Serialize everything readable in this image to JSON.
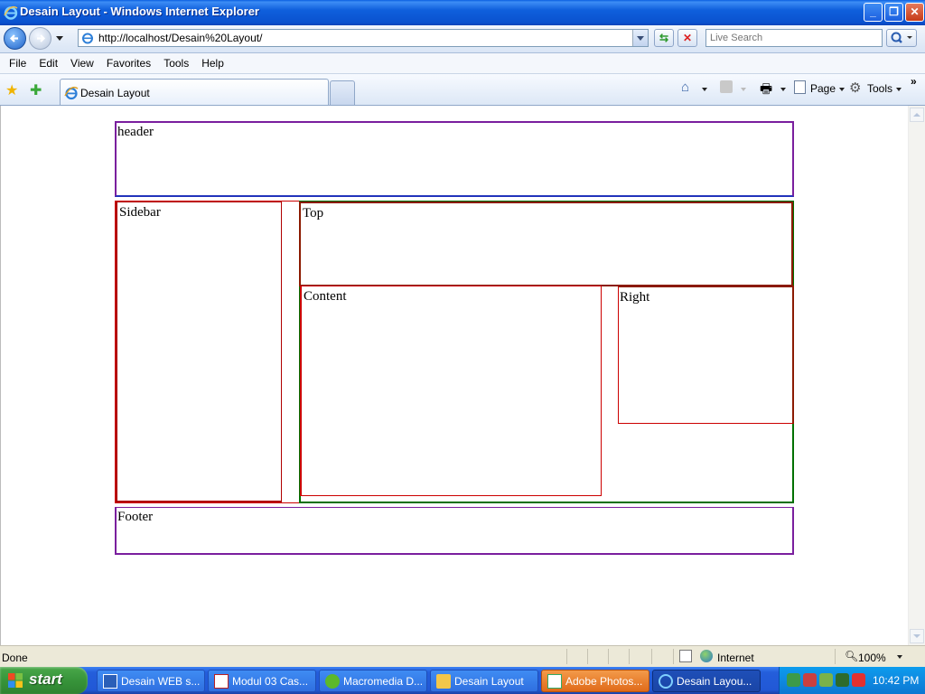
{
  "window": {
    "title": "Desain Layout - Windows Internet Explorer"
  },
  "address_bar": {
    "url": "http://localhost/Desain%20Layout/"
  },
  "search": {
    "placeholder": "Live Search"
  },
  "menu": [
    "File",
    "Edit",
    "View",
    "Favorites",
    "Tools",
    "Help"
  ],
  "tabs": [
    {
      "label": "Desain Layout",
      "active": true
    }
  ],
  "command_bar": {
    "page_label": "Page",
    "tools_label": "Tools"
  },
  "page": {
    "header": "header",
    "sidebar": "Sidebar",
    "top": "Top",
    "content": "Content",
    "right": "Right",
    "footer": "Footer"
  },
  "status_bar": {
    "status": "Done",
    "zone": "Internet",
    "zoom": "100%"
  },
  "taskbar": {
    "start_label": "start",
    "tasks": [
      {
        "label": "Desain WEB s..."
      },
      {
        "label": "Modul 03 Cas..."
      },
      {
        "label": "Macromedia D..."
      },
      {
        "label": "Desain Layout"
      },
      {
        "label": "Adobe Photos..."
      },
      {
        "label": "Desain Layou..."
      }
    ],
    "clock": "10:42 PM"
  },
  "colors": {
    "header_border": "#7a1f9e",
    "sidebar_border": "#b00000",
    "top_border": "#8b1a00",
    "content_border": "#cc0000",
    "main_border": "#007000",
    "footer_border": "#7a1f9e"
  }
}
